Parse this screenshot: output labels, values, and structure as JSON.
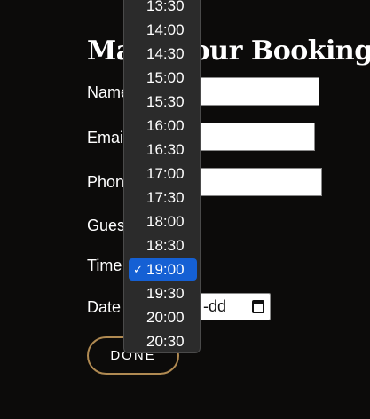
{
  "form": {
    "title": "Make Your Booking",
    "labels": {
      "name": "Name",
      "email": "Email",
      "phone": "Phone",
      "guests": "Guests",
      "time": "Time",
      "date": "Date"
    },
    "date_placeholder": "yyyy-mm-dd",
    "done_label": "DONE"
  },
  "time_dropdown": {
    "options": [
      "13:30",
      "14:00",
      "14:30",
      "15:00",
      "15:30",
      "16:00",
      "16:30",
      "17:00",
      "17:30",
      "18:00",
      "18:30",
      "19:00",
      "19:30",
      "20:00",
      "20:30"
    ],
    "selected": "19:00",
    "check_mark": "✓"
  },
  "colors": {
    "background": "#0c0b0a",
    "button_border": "#b08a52",
    "selected_option": "#1560d4",
    "dropdown_bg": "#2b2b2b"
  }
}
